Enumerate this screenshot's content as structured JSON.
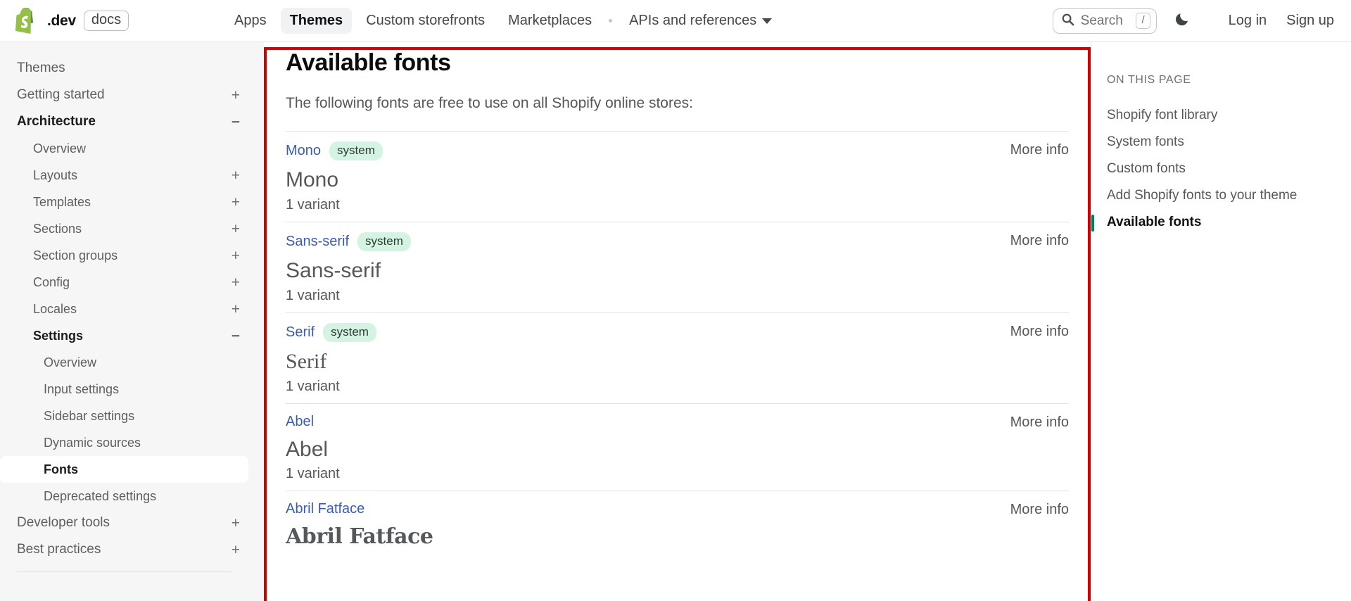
{
  "header": {
    "logo_icon": "shopify-bag-icon",
    "brand_dev": ".dev",
    "brand_docs": "docs",
    "nav": [
      {
        "label": "Apps",
        "active": false,
        "caret": false
      },
      {
        "label": "Themes",
        "active": true,
        "caret": false
      },
      {
        "label": "Custom storefronts",
        "active": false,
        "caret": false
      },
      {
        "label": "Marketplaces",
        "active": false,
        "caret": false
      },
      {
        "label": "APIs and references",
        "active": false,
        "caret": true
      }
    ],
    "search": {
      "placeholder": "Search",
      "shortcut": "/",
      "icon": "search-icon"
    },
    "theme_toggle_icon": "moon-icon",
    "log_in": "Log in",
    "sign_up": "Sign up"
  },
  "sidebar": {
    "items": [
      {
        "label": "Themes",
        "level": 1,
        "toggle": "",
        "state": "plain"
      },
      {
        "label": "Getting started",
        "level": 1,
        "toggle": "+",
        "state": "plain"
      },
      {
        "label": "Architecture",
        "level": 1,
        "toggle": "−",
        "state": "bold"
      },
      {
        "label": "Overview",
        "level": 2,
        "toggle": "",
        "state": "plain"
      },
      {
        "label": "Layouts",
        "level": 2,
        "toggle": "+",
        "state": "plain"
      },
      {
        "label": "Templates",
        "level": 2,
        "toggle": "+",
        "state": "plain"
      },
      {
        "label": "Sections",
        "level": 2,
        "toggle": "+",
        "state": "plain"
      },
      {
        "label": "Section groups",
        "level": 2,
        "toggle": "+",
        "state": "plain"
      },
      {
        "label": "Config",
        "level": 2,
        "toggle": "+",
        "state": "plain"
      },
      {
        "label": "Locales",
        "level": 2,
        "toggle": "+",
        "state": "plain"
      },
      {
        "label": "Settings",
        "level": 2,
        "toggle": "−",
        "state": "bold"
      },
      {
        "label": "Overview",
        "level": 3,
        "toggle": "",
        "state": "plain"
      },
      {
        "label": "Input settings",
        "level": 3,
        "toggle": "",
        "state": "plain"
      },
      {
        "label": "Sidebar settings",
        "level": 3,
        "toggle": "",
        "state": "plain"
      },
      {
        "label": "Dynamic sources",
        "level": 3,
        "toggle": "",
        "state": "plain"
      },
      {
        "label": "Fonts",
        "level": 3,
        "toggle": "",
        "state": "current"
      },
      {
        "label": "Deprecated settings",
        "level": 3,
        "toggle": "",
        "state": "plain"
      },
      {
        "label": "Developer tools",
        "level": 1,
        "toggle": "+",
        "state": "plain"
      },
      {
        "label": "Best practices",
        "level": 1,
        "toggle": "+",
        "state": "plain"
      }
    ]
  },
  "main": {
    "title": "Available fonts",
    "intro": "The following fonts are free to use on all Shopify online stores:",
    "more_info_label": "More info",
    "fonts": [
      {
        "name": "Mono",
        "badge": "system",
        "preview": "Mono",
        "variants": "1 variant",
        "style": "mono"
      },
      {
        "name": "Sans-serif",
        "badge": "system",
        "preview": "Sans-serif",
        "variants": "1 variant",
        "style": "sans"
      },
      {
        "name": "Serif",
        "badge": "system",
        "preview": "Serif",
        "variants": "1 variant",
        "style": "serif"
      },
      {
        "name": "Abel",
        "badge": "",
        "preview": "Abel",
        "variants": "1 variant",
        "style": "sans"
      },
      {
        "name": "Abril Fatface",
        "badge": "",
        "preview": "Abril Fatface",
        "variants": "",
        "style": "display"
      }
    ]
  },
  "toc": {
    "heading": "ON THIS PAGE",
    "items": [
      {
        "label": "Shopify font library",
        "active": false
      },
      {
        "label": "System fonts",
        "active": false
      },
      {
        "label": "Custom fonts",
        "active": false
      },
      {
        "label": "Add Shopify fonts to your theme",
        "active": false
      },
      {
        "label": "Available fonts",
        "active": true
      }
    ]
  },
  "colors": {
    "accent_green": "#008060",
    "link_blue": "#3b5bb5",
    "badge_bg": "#d5f3e3",
    "highlight_border": "#d00000"
  }
}
